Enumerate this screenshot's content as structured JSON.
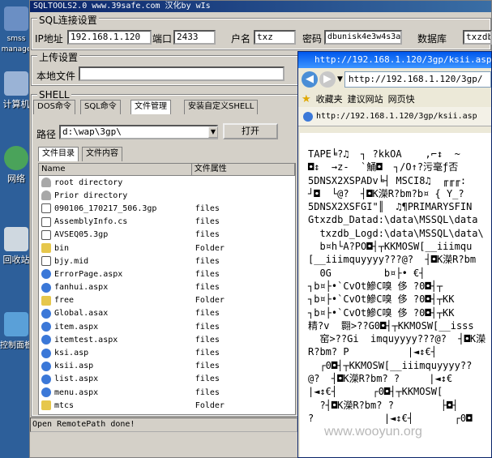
{
  "desktop": {
    "icons": [
      {
        "label": "smss\nmanage"
      },
      {
        "label": "计算机"
      },
      {
        "label": "网络"
      },
      {
        "label": "回收站"
      },
      {
        "label": "控制面板"
      }
    ]
  },
  "app": {
    "title": "SQLTOOLS2.0 www.39safe.com 汉化by wIs",
    "sql_connect": {
      "group_title": "SQL连接设置",
      "ip_label": "IP地址",
      "ip_value": "192.168.1.120",
      "port_label": "端口",
      "port_value": "2433",
      "user_label": "户名",
      "user_value": "txz",
      "pass_label": "密码",
      "pass_value": "dbunisk4e3w4s3a",
      "db_label": "数据库",
      "db_value": "txzdb"
    },
    "upload": {
      "group_title": "上传设置",
      "local_file_label": "本地文件",
      "local_file_value": ""
    },
    "shell": {
      "group_title": "SHELL",
      "tabs": [
        "DOS命令",
        "SQL命令",
        "文件管理",
        "安装自定义SHELL"
      ],
      "active_tab": "文件管理",
      "path_label": "路径",
      "path_value": "d:\\wap\\3gp\\",
      "open_button": "打开",
      "subtabs": [
        "文件目录",
        "文件内容"
      ],
      "columns": [
        "Name",
        "文件属性"
      ],
      "rows": [
        {
          "name": "root directory",
          "type": "",
          "icon": "dir"
        },
        {
          "name": "Prior directory",
          "type": "",
          "icon": "dir"
        },
        {
          "name": "090106_170217_506.3gp",
          "type": "files",
          "icon": "file"
        },
        {
          "name": "AssemblyInfo.cs",
          "type": "files",
          "icon": "file"
        },
        {
          "name": "AVSEQ05.3gp",
          "type": "files",
          "icon": "file"
        },
        {
          "name": "bin",
          "type": "Folder",
          "icon": "folder"
        },
        {
          "name": "bjy.mid",
          "type": "files",
          "icon": "file"
        },
        {
          "name": "ErrorPage.aspx",
          "type": "files",
          "icon": "ie"
        },
        {
          "name": "fanhui.aspx",
          "type": "files",
          "icon": "ie"
        },
        {
          "name": "free",
          "type": "Folder",
          "icon": "folder"
        },
        {
          "name": "Global.asax",
          "type": "files",
          "icon": "ie"
        },
        {
          "name": "item.aspx",
          "type": "files",
          "icon": "ie"
        },
        {
          "name": "itemtest.aspx",
          "type": "files",
          "icon": "ie"
        },
        {
          "name": "ksi.asp",
          "type": "files",
          "icon": "ie"
        },
        {
          "name": "ksii.asp",
          "type": "files",
          "icon": "ie"
        },
        {
          "name": "list.aspx",
          "type": "files",
          "icon": "ie"
        },
        {
          "name": "menu.aspx",
          "type": "files",
          "icon": "ie"
        },
        {
          "name": "mtcs",
          "type": "Folder",
          "icon": "folder"
        }
      ]
    },
    "status": "Open RemotePath done!"
  },
  "browser": {
    "title": "http://192.168.1.120/3gp/ksii.asp",
    "address": "http://192.168.1.120/3gp/",
    "favorites_label": "收藏夹",
    "suggest_label": "建议网站",
    "webslice_label": "网页快",
    "tab_title": "http://192.168.1.120/3gp/ksii.asp",
    "content_lines": [
      "TAPE╘?♫  ┐ ?kkOA    ,⌐↕  ~",
      "◘↕  →z-  `鯒◘  ┐/O↑?污毫ƒ否",
      "5DNSX2XSPADv╘┤ MSCI8♫  ╓╓╓:",
      "┘◘  └@?  ┤◘K濚R?bm?b¤ { Y_?",
      "5DNSX2XSFGI\"║  ♫¶PRIMARYSFIN",
      "Gtxzdb_Datad:\\data\\MSSQL\\data",
      "  txzdb_Logd:\\data\\MSSQL\\data\\",
      "  b¤h└A?PO◘┤┬KKMOSW[__iiimqu",
      "[__iiimquyyyy???@?  ┤◘K濚R?bm",
      "  0G         b¤├• €┤",
      "┐b¤├•`CvOt鰺C嗅 侈 ?0◘┤┬",
      "┐b¤├•`CvOt鰺C嗅 侈 ?0◘┤┬KK",
      "┐b¤├•`CvOt鰺C嗅 侈 ?0◘┤┬KK",
      "精?v  翾>??G0◘┤┬KKMOSW[__isss",
      "  窑>??Gi  imquyyyy???@?  ┤◘K濚",
      "R?bm? P          |◄↕€┤",
      "  ┌0◘┤┬KKMOSW[__iiimquyyyy??",
      "@?  ┤◘K濚R?bm? ?     |◄↕€",
      "|◄↕€┤      ┌0◘┤┬KKMOSW[",
      "  ?┤◘K濚R?bm? ?        ├◘┤",
      "?            |◄↕€┤       ┌0◘"
    ]
  },
  "watermark": "www.wooyun.org",
  "colors": {
    "title_bar": "#0a246a",
    "window_face": "#d4d0c8",
    "desktop": "#3a6ea5"
  }
}
